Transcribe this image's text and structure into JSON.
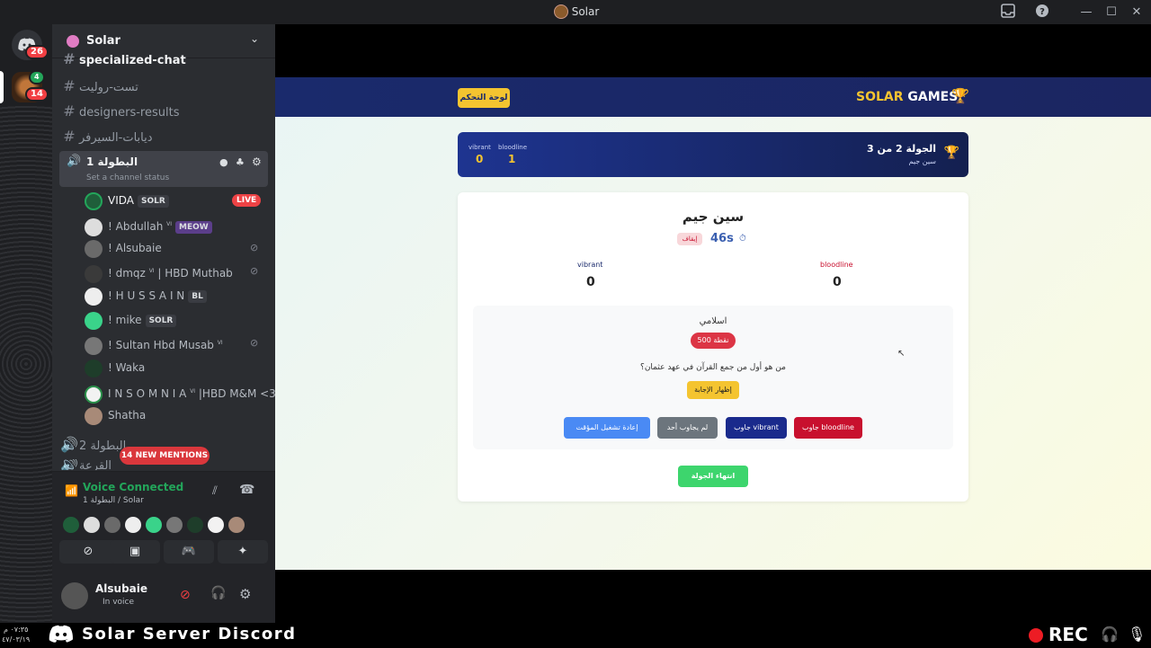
{
  "window": {
    "title": "Solar"
  },
  "servers": {
    "dm_badge": "26",
    "server_badge": "14",
    "voice_count": "4"
  },
  "server": {
    "name": "Solar"
  },
  "channels": [
    {
      "name": "specialized-chat"
    },
    {
      "name": "تست-روليت"
    },
    {
      "name": "designers-results"
    },
    {
      "name": "ديابات-السيرفر"
    }
  ],
  "voice_channel": {
    "name": "البطولة 1",
    "status": "Set a channel status",
    "users": [
      {
        "name": "VIDA",
        "tag": "SOLR",
        "live": "LIVE"
      },
      {
        "name": "! Abdullah",
        "sup": "VI",
        "tag": "MEOW"
      },
      {
        "name": "! Alsubaie"
      },
      {
        "name": "! dmqz",
        "sup": "VI",
        "suffix": "| HBD Muthab"
      },
      {
        "name": "! H U S S A I N",
        "tag": "BL"
      },
      {
        "name": "! mike",
        "tag": "SOLR"
      },
      {
        "name": "! Sultan Hbd Musab",
        "sup": "VI"
      },
      {
        "name": "! Waka"
      },
      {
        "name": "I N S O M N I A",
        "sup": "VI",
        "suffix": "|HBD M&M <3|"
      },
      {
        "name": "Shatha"
      }
    ]
  },
  "voice_channel_2": {
    "name": "البطولة 2"
  },
  "voice_channel_3": {
    "name": "القرعة"
  },
  "mentions": "14 NEW MENTIONS",
  "voice_panel": {
    "status": "Voice Connected",
    "location": "البطولة 1 / Solar"
  },
  "user_panel": {
    "name": "Alsubaie",
    "status": "In voice"
  },
  "game": {
    "brand_solar": "SOLAR",
    "brand_games": "GAMES",
    "dashboard_button": "لوحة التحكم",
    "round_title": "الجولة 2 من 3",
    "round_subtitle": "سين جيم",
    "team1": {
      "name": "bloodline",
      "score": "1"
    },
    "team2": {
      "name": "vibrant",
      "score": "0"
    },
    "card_title": "سين جيم",
    "timer": "46s",
    "pause_label": "إيقاف",
    "card_team1": {
      "name": "bloodline",
      "score": "0"
    },
    "card_team2": {
      "name": "vibrant",
      "score": "0"
    },
    "category": "اسلامي",
    "points": "500 نقطة",
    "question": "من هو أول من جمع القرآن في عهد عثمان؟",
    "show_answer": "إظهار الإجابة",
    "answer_bloodline": "جاوب bloodline",
    "answer_vibrant": "جاوب vibrant",
    "no_answer": "لم يجاوب أحد",
    "restart_timer": "إعادة تشغيل المؤقت",
    "end_round": "انتهاء الجولة"
  },
  "footer": {
    "time": "٠٧:٣٥ م",
    "date": "٤٧/٠٣/١٩",
    "banner": "Solar Server Discord",
    "rec": "REC"
  },
  "colors": {
    "discord_dark": "#1e1f22",
    "channel_bg": "#2b2d31",
    "navy": "#1a2a6c",
    "gold": "#f4c430",
    "red": "#c8102e",
    "green": "#3dd56d",
    "blue": "#4a8af4",
    "live_red": "#ed4245",
    "voice_green": "#23a55a"
  }
}
